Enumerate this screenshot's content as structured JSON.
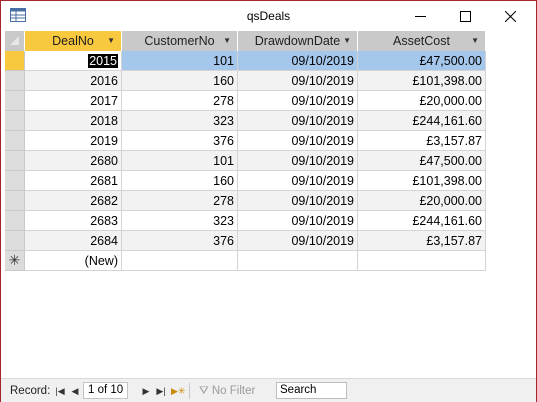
{
  "window": {
    "title": "qsDeals"
  },
  "columns": [
    "DealNo",
    "CustomerNo",
    "DrawdownDate",
    "AssetCost"
  ],
  "rows": [
    [
      "2015",
      "101",
      "09/10/2019",
      "£47,500.00"
    ],
    [
      "2016",
      "160",
      "09/10/2019",
      "£101,398.00"
    ],
    [
      "2017",
      "278",
      "09/10/2019",
      "£20,000.00"
    ],
    [
      "2018",
      "323",
      "09/10/2019",
      "£244,161.60"
    ],
    [
      "2019",
      "376",
      "09/10/2019",
      "£3,157.87"
    ],
    [
      "2680",
      "101",
      "09/10/2019",
      "£47,500.00"
    ],
    [
      "2681",
      "160",
      "09/10/2019",
      "£101,398.00"
    ],
    [
      "2682",
      "278",
      "09/10/2019",
      "£20,000.00"
    ],
    [
      "2683",
      "323",
      "09/10/2019",
      "£244,161.60"
    ],
    [
      "2684",
      "376",
      "09/10/2019",
      "£3,157.87"
    ]
  ],
  "new_row_label": "(New)",
  "new_row_marker": "✳",
  "navbar": {
    "record_label": "Record:",
    "record_position": "1 of 10",
    "filter_label": "No Filter",
    "search_label": "Search"
  },
  "colors": {
    "accent": "#f8c93f",
    "selection": "#a5c7ec",
    "border": "#a4262c"
  }
}
